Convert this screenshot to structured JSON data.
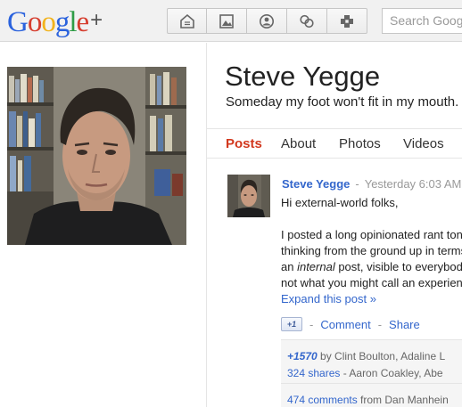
{
  "header": {
    "logo_letters": [
      {
        "ch": "G",
        "color": "#2a62dd"
      },
      {
        "ch": "o",
        "color": "#d63e2f"
      },
      {
        "ch": "o",
        "color": "#f2b31c"
      },
      {
        "ch": "g",
        "color": "#2a62dd"
      },
      {
        "ch": "l",
        "color": "#2f9c46"
      },
      {
        "ch": "e",
        "color": "#d63e2f"
      }
    ],
    "logo_plus": "+",
    "nav_icons": [
      "home-icon",
      "photos-icon",
      "profile-icon",
      "circles-icon",
      "games-icon"
    ],
    "search_placeholder": "Search Goog"
  },
  "profile": {
    "name": "Steve Yegge",
    "tagline": "Someday my foot won't fit in my mouth."
  },
  "tabs": [
    "Posts",
    "About",
    "Photos",
    "Videos"
  ],
  "active_tab": "Posts",
  "post": {
    "author": "Steve Yegge",
    "time": "Yesterday 6:03 AM",
    "lines": [
      "Hi external-world folks,",
      "",
      "I posted a long opinionated rant ton",
      "thinking from the ground up in terms",
      "an internal post, visible to everybod",
      "not what you might call an experien"
    ],
    "internal_word": "internal",
    "expand": "Expand this post »",
    "plusone": "+1",
    "comment": "Comment",
    "share": "Share"
  },
  "stats": {
    "plus_count": "+1570",
    "plus_by": "by Clint Boulton, Adaline L",
    "shares": "324 shares",
    "shares_by": "- Aaron Coakley, Abe",
    "comments": "474 comments",
    "comments_from": "from Dan Manhein"
  },
  "colors": {
    "accent_red": "#d2381e",
    "link_blue": "#3366cc"
  }
}
